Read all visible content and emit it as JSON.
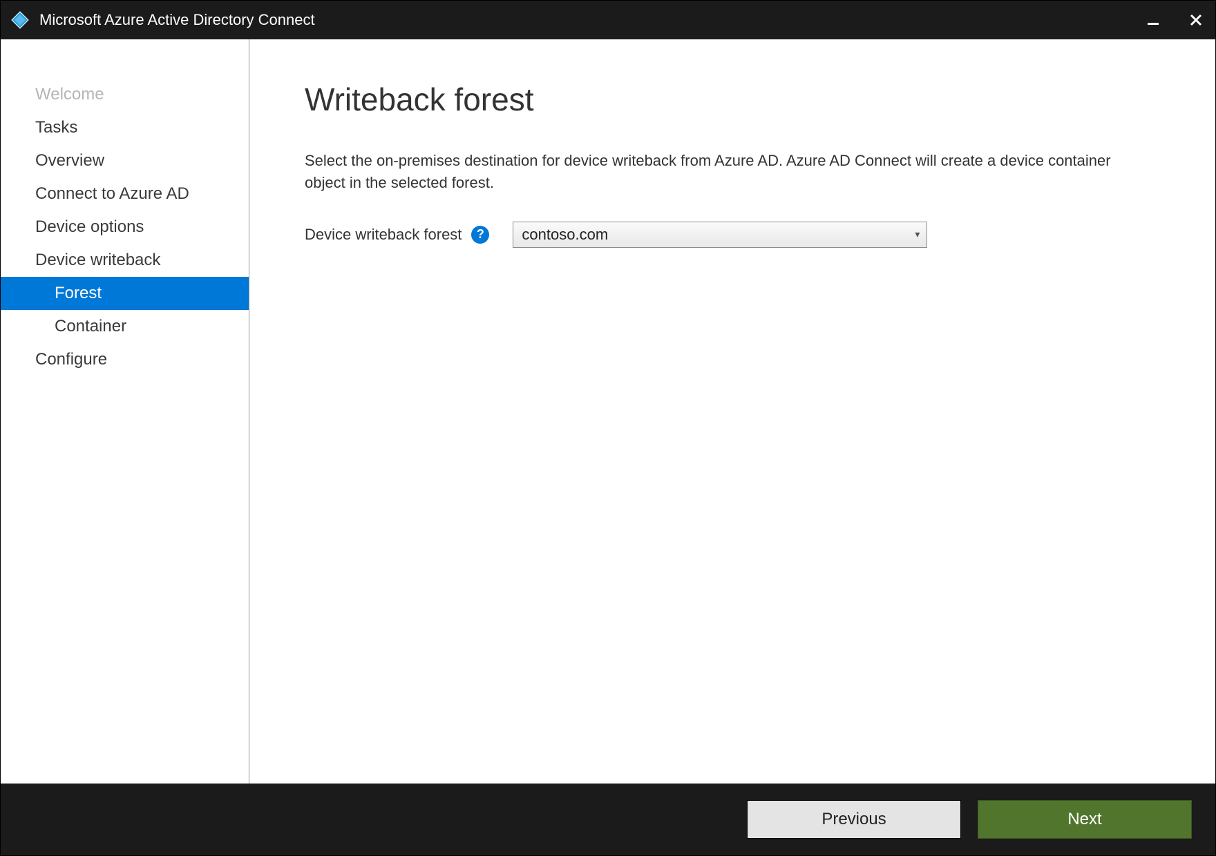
{
  "titlebar": {
    "app_title": "Microsoft Azure Active Directory Connect"
  },
  "sidebar": {
    "items": [
      {
        "label": "Welcome",
        "state": "disabled",
        "indent": 0
      },
      {
        "label": "Tasks",
        "state": "normal",
        "indent": 0
      },
      {
        "label": "Overview",
        "state": "normal",
        "indent": 0
      },
      {
        "label": "Connect to Azure AD",
        "state": "normal",
        "indent": 0
      },
      {
        "label": "Device options",
        "state": "normal",
        "indent": 0
      },
      {
        "label": "Device writeback",
        "state": "normal",
        "indent": 0
      },
      {
        "label": "Forest",
        "state": "selected",
        "indent": 1
      },
      {
        "label": "Container",
        "state": "normal",
        "indent": 1
      },
      {
        "label": "Configure",
        "state": "normal",
        "indent": 0
      }
    ]
  },
  "main": {
    "title": "Writeback forest",
    "description": "Select the on-premises destination for device writeback from Azure AD.  Azure AD Connect will create a device container object in the selected forest.",
    "field_label": "Device writeback forest",
    "dropdown_value": "contoso.com"
  },
  "footer": {
    "previous_label": "Previous",
    "next_label": "Next"
  },
  "colors": {
    "accent": "#0078d7",
    "next_button": "#51752d"
  }
}
